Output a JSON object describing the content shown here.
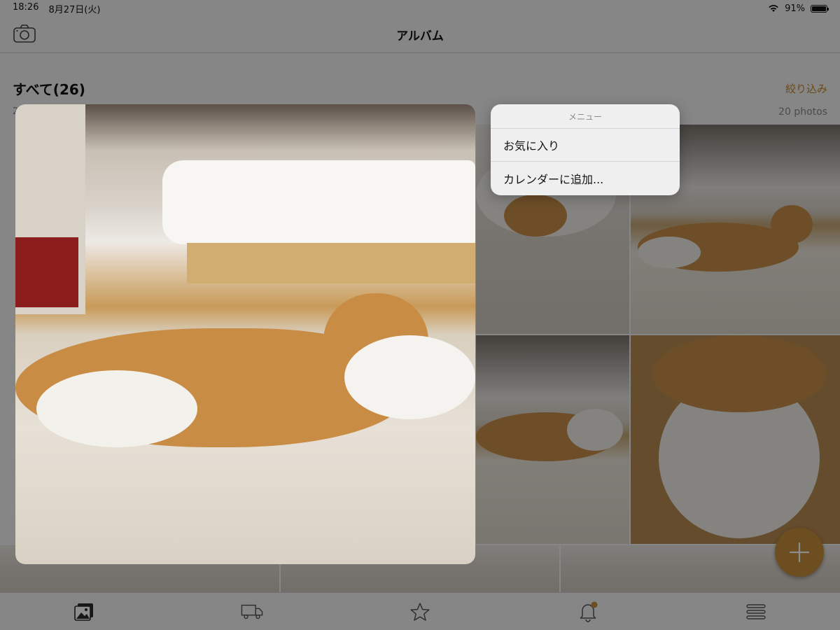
{
  "status_bar": {
    "time": "18:26",
    "date": "8月27日(火)",
    "battery": "91%",
    "battery_level": 0.91
  },
  "nav": {
    "title": "アルバム",
    "camera_icon": "camera-icon"
  },
  "section": {
    "title": "すべて(26)",
    "filter_label": "絞り込み",
    "left_subline": "2",
    "photo_count": "20 photos"
  },
  "tabbar": {
    "tabs": [
      {
        "icon": "photos-icon",
        "active": true
      },
      {
        "icon": "truck-icon",
        "active": false
      },
      {
        "icon": "star-icon",
        "active": false
      },
      {
        "icon": "bell-icon",
        "active": false,
        "badge": true
      },
      {
        "icon": "menu-icon",
        "active": false
      }
    ]
  },
  "fab": {
    "icon": "plus-icon"
  },
  "context_menu": {
    "title": "メニュー",
    "items": [
      {
        "label": "お気に入り"
      },
      {
        "label": "カレンダーに追加..."
      }
    ]
  },
  "colors": {
    "accent": "#c78f3c",
    "filter": "#c7872a",
    "overlay": "rgba(0,0,0,0.45)"
  }
}
